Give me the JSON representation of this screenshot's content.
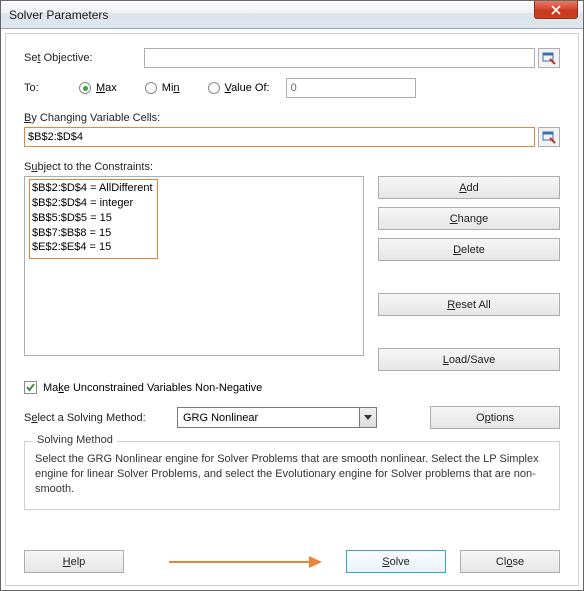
{
  "title": "Solver Parameters",
  "labels": {
    "set_objective": "Set Objective:",
    "to": "To:",
    "max": "Max",
    "min": "Min",
    "value_of": "Value Of:",
    "by_changing": "By Changing Variable Cells:",
    "subject_to": "Subject to the Constraints:",
    "make_unconstrained": "Make Unconstrained Variables Non-Negative",
    "select_method": "Select a Solving Method:",
    "solving_method_group": "Solving Method"
  },
  "objective_value": "",
  "value_of_value": "0",
  "changing_cells_value": "$B$2:$D$4",
  "constraints": [
    "$B$2:$D$4 = AllDifferent",
    "$B$2:$D$4 = integer",
    "$B$5:$D$5 = 15",
    "$B$7:$B$8 = 15",
    "$E$2:$E$4 = 15"
  ],
  "buttons": {
    "add": "Add",
    "change": "Change",
    "delete": "Delete",
    "reset_all": "Reset All",
    "load_save": "Load/Save",
    "options": "Options",
    "help": "Help",
    "solve": "Solve",
    "close": "Close"
  },
  "method_selected": "GRG Nonlinear",
  "help_text": "Select the GRG Nonlinear engine for Solver Problems that are smooth nonlinear. Select the LP Simplex engine for linear Solver Problems, and select the Evolutionary engine for Solver problems that are non-smooth.",
  "radio_selected": "max",
  "checkbox_checked": true
}
